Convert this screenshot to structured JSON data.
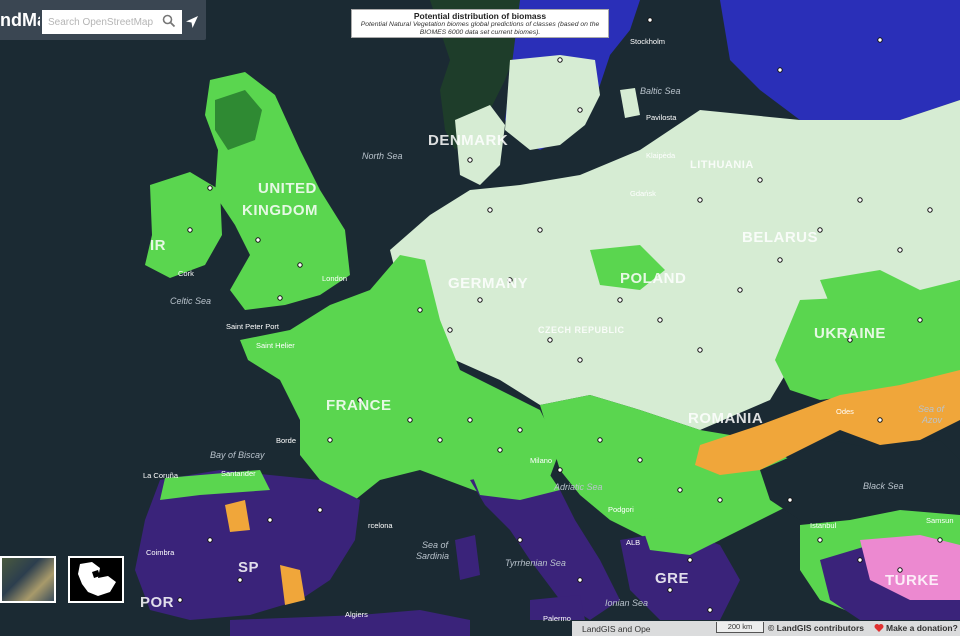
{
  "app": {
    "brand": "ndMap"
  },
  "search": {
    "placeholder": "Search OpenStreetMap"
  },
  "legend": {
    "title": "Potential distribution of biomass",
    "description_line1": "Potential Natural Vegetation biomes global predictions of classes (based on the",
    "description_line2": "BIOMES 6000 data set current biomes)."
  },
  "labels": {
    "countries": {
      "uk1": "UNITED",
      "uk2": "KINGDOM",
      "denmark": "DENMARK",
      "germany": "GERMANY",
      "poland": "POLAND",
      "france": "FRANCE",
      "belarus": "BELARUS",
      "ukraine": "UKRAINE",
      "lithuania": "LITHUANIA",
      "romania": "ROMANIA",
      "portugal": "POR",
      "spain": "SP",
      "ireland": "IR",
      "greece": "GRE",
      "turkey": "TURKE",
      "czech": "CZECH REPUBLIC"
    },
    "seas": {
      "north_sea": "North Sea",
      "baltic_sea": "Baltic Sea",
      "celtic_sea": "Celtic Sea",
      "biscay": "Bay of Biscay",
      "adriatic": "Adriatic Sea",
      "tyrrhenian": "Tyrrhenian Sea",
      "sardinia1": "Sea of",
      "sardinia2": "Sardinia",
      "ionian": "Ionian Sea",
      "black_sea": "Black Sea",
      "azov1": "Sea of",
      "azov2": "Azov"
    },
    "cities": {
      "stockholm": "Stockholm",
      "pavilosta": "Pavilosta",
      "klaipeda": "Klaipėda",
      "gdansk": "Gdańsk",
      "cork": "Cork",
      "london": "London",
      "saint_peter_port": "Saint Peter Port",
      "saint_helier": "Saint Helier",
      "bordeaux": "Borde",
      "santander": "Santander",
      "la_coruna": "La Coruña",
      "coimbra": "Coimbra",
      "barcelona": "rcelona",
      "algiers": "Algiers",
      "palermo": "Palermo",
      "istanbul": "Istanbul",
      "samsun": "Samsun",
      "odesa": "Odes",
      "podgorica": "Podgori",
      "alb": "ALB",
      "milano": "Milano"
    }
  },
  "footer": {
    "attribution": "LandGIS and Ope",
    "scale": "200 km",
    "copyright": "© LandGIS contributors",
    "donation": "Make a donation?"
  },
  "colors": {
    "ocean": "#1b2a33",
    "forest_light": "#d6ecd3",
    "forest_green": "#5ad64f",
    "steppe_orange": "#f0a63a",
    "tundra_blue": "#2a2fb8",
    "mediterranean_purple": "#3a237a",
    "desert_pink": "#ec89d0"
  }
}
